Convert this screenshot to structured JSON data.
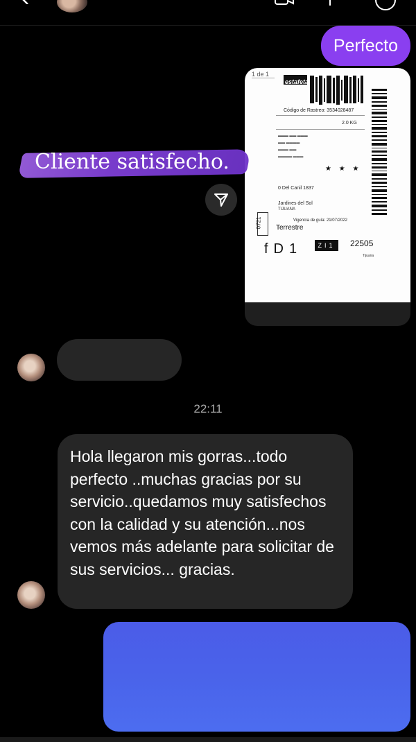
{
  "conversation": {
    "outgoing_message_1": "Perfecto",
    "story_reply": {
      "caption": "Cliente satisfecho.",
      "label": {
        "pager": "1 de 1",
        "logo": "estafeta",
        "weight": "2.0 KG",
        "recipient_line_1": "Jardines del Sol",
        "recipient_line_2": "TIJUANA",
        "vigencia_label": "Vigencia de guía:",
        "vigencia_date": "21/07/2022",
        "service": "Terrestre",
        "side_code": "0721",
        "route": "fD1",
        "zone": "ZI1",
        "postal_code": "22505",
        "rastreo_label": "Código de Rastreo:",
        "rastreo_number": "3534028487",
        "stars": "★ ★ ★",
        "street": "0 Del Canil 1837",
        "city_footer": "Tijuana"
      }
    },
    "timestamp": "22:11",
    "incoming_message": "Hola llegaron mis gorras...todo perfecto ..muchas gracias por su servicio..quedamos muy satisfechos con la calidad y su atención...nos vemos más adelante para solicitar de sus servicios... gracias."
  },
  "colors": {
    "outgoing_bubble": "#8a3ff0",
    "incoming_bubble": "#262626",
    "blue_bubble": "#4b5ce8",
    "background": "#000000"
  },
  "icons": [
    "back-icon",
    "video-call-icon",
    "phone-icon",
    "info-icon",
    "share-icon"
  ]
}
